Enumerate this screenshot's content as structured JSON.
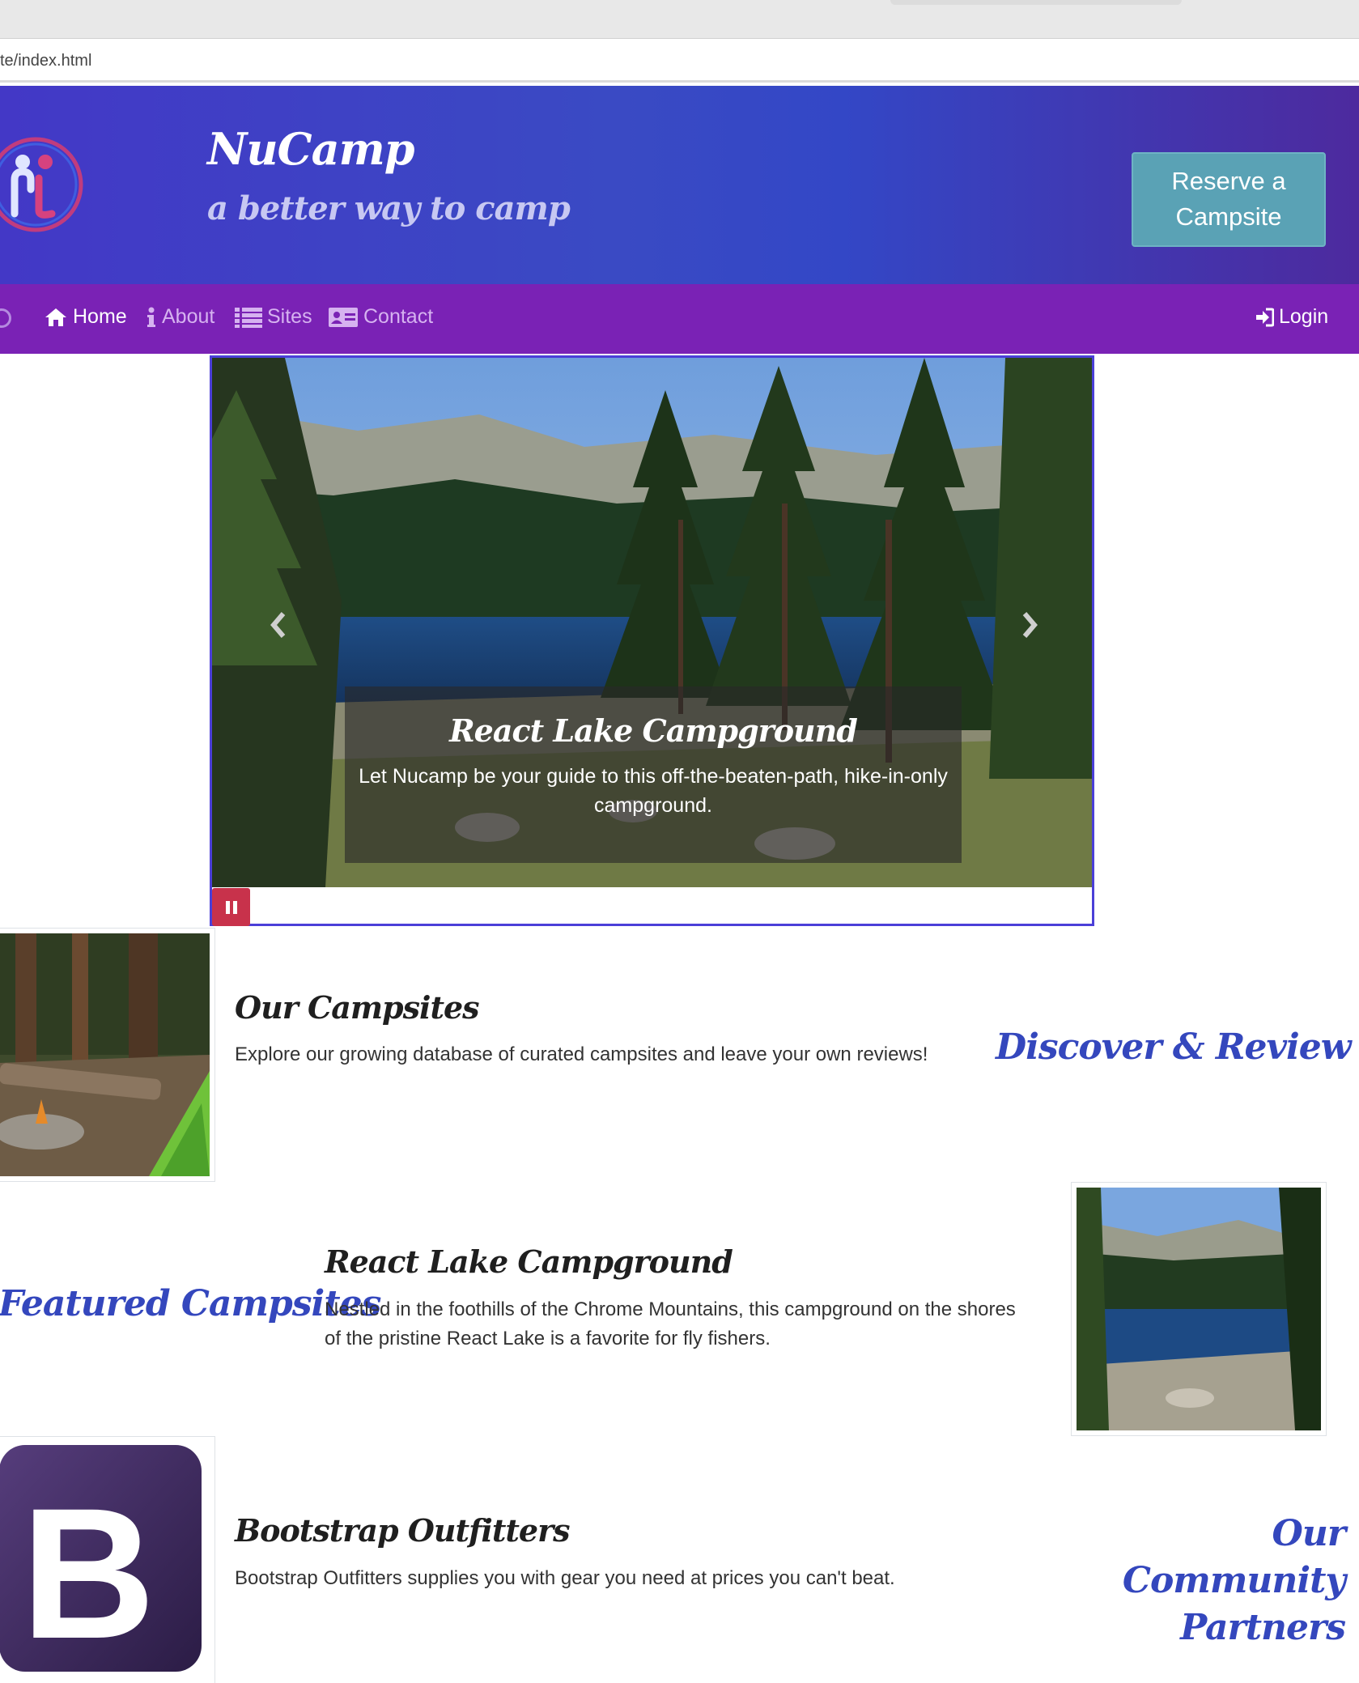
{
  "browser": {
    "url_fragment": "te/index.html"
  },
  "header": {
    "brand": "NuCamp",
    "tagline": "a better way to camp",
    "reserve_button": "Reserve a Campsite"
  },
  "navbar": {
    "items": [
      {
        "label": "Home",
        "icon": "home-icon",
        "active": true
      },
      {
        "label": "About",
        "icon": "info-icon",
        "active": false
      },
      {
        "label": "Sites",
        "icon": "list-icon",
        "active": false
      },
      {
        "label": "Contact",
        "icon": "address-card-icon",
        "active": false
      }
    ],
    "login": "Login"
  },
  "carousel": {
    "caption_title": "React Lake Campground",
    "caption_text": "Let Nucamp be your guide to this off-the-beaten-path, hike-in-only campground."
  },
  "sections": [
    {
      "title": "Our Campsites",
      "text": "Explore our growing database of curated campsites and leave your own reviews!",
      "heading": "Discover & Review"
    },
    {
      "title": "React Lake Campground",
      "text": "Nestled in the foothills of the Chrome Mountains, this campground on the shores of the pristine React Lake is a favorite for fly fishers.",
      "heading": "Featured Campsites"
    },
    {
      "title": "Bootstrap Outfitters",
      "text": "Bootstrap Outfitters supplies you with gear you need at prices you can't beat.",
      "heading": "Our Community Partners",
      "logo_letter": "B"
    }
  ],
  "colors": {
    "header_gradient_start": "#4338c6",
    "header_gradient_end": "#4d2a9e",
    "navbar": "#7a22b5",
    "reserve_button": "#5aa2b5",
    "heading_blue": "#3447bd",
    "carousel_border": "#4b3fd8",
    "pause_button": "#c8324b",
    "bootstrap_purple": "#563d7c"
  }
}
